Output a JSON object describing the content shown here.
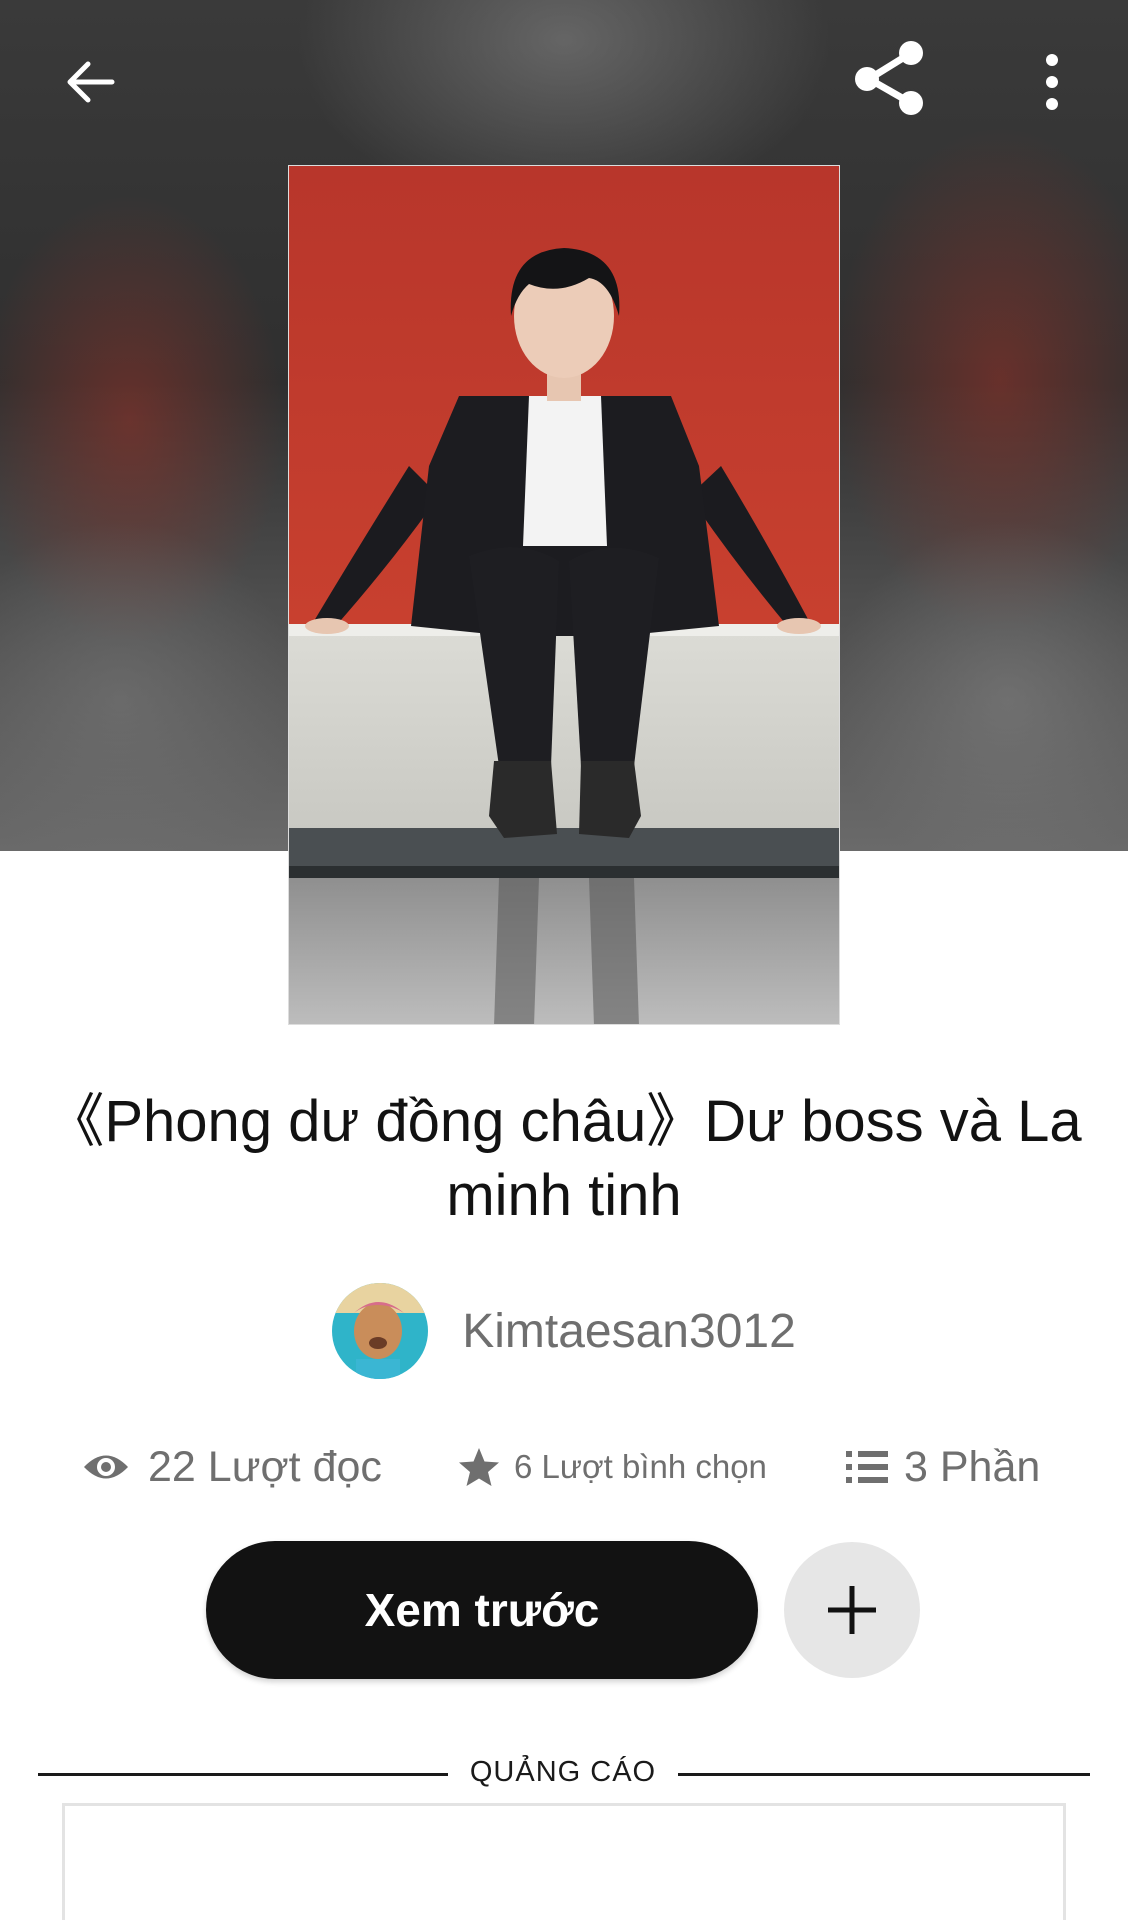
{
  "header": {
    "back_icon": "arrow-left-icon",
    "share_icon": "share-icon",
    "more_icon": "more-vertical-icon"
  },
  "story": {
    "title": "《Phong dư đồng châu》Dư boss và La minh tinh",
    "author": "Kimtaesan3012"
  },
  "stats": {
    "reads": "22 Lượt đọc",
    "reads_icon": "eye-icon",
    "votes": "6 Lượt bình chọn",
    "votes_icon": "star-icon",
    "parts": "3 Phần",
    "parts_icon": "list-icon"
  },
  "actions": {
    "read_label": "Xem trước",
    "add_icon": "plus-icon"
  },
  "ad": {
    "label": "QUẢNG CÁO"
  },
  "colors": {
    "primary_button": "#121212",
    "secondary_button": "#e6e6e6",
    "muted_text": "#6f6f6f",
    "cover_wall": "#c0392b"
  }
}
